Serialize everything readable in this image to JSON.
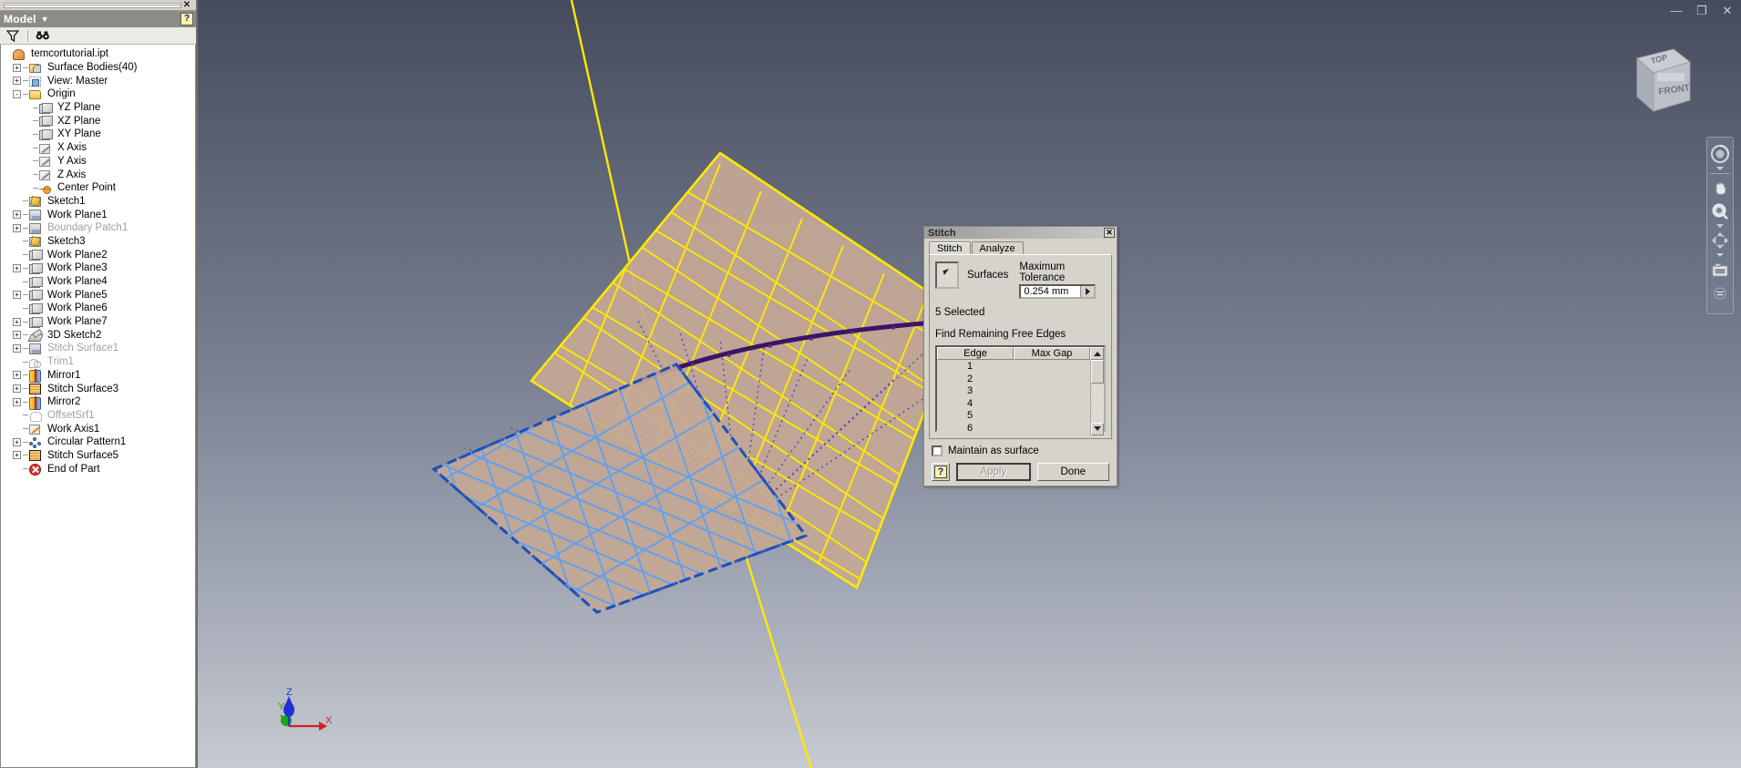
{
  "window": {
    "controls": [
      {
        "name": "minimize-button",
        "glyph": "—"
      },
      {
        "name": "restore-button",
        "glyph": "❐"
      },
      {
        "name": "close-button",
        "glyph": "✕"
      }
    ]
  },
  "browser": {
    "close_glyph": "✕",
    "title": "Model",
    "title_carat": "▼",
    "help_glyph": "?",
    "tools": [
      {
        "name": "filter-icon",
        "title": "Filter"
      },
      {
        "name": "find-icon",
        "title": "Find"
      }
    ],
    "tree": [
      {
        "label": "temcortutorial.ipt",
        "icon": "doc",
        "indent": 0,
        "expander": "none",
        "dim": false
      },
      {
        "label": "Surface Bodies(40)",
        "icon": "surfbody",
        "indent": 1,
        "expander": "+",
        "dim": false
      },
      {
        "label": "View: Master",
        "icon": "view",
        "indent": 1,
        "expander": "+",
        "dim": false
      },
      {
        "label": "Origin",
        "icon": "folder",
        "indent": 1,
        "expander": "-",
        "dim": false
      },
      {
        "label": "YZ Plane",
        "icon": "plane",
        "indent": 2,
        "expander": "none",
        "dim": false
      },
      {
        "label": "XZ Plane",
        "icon": "plane",
        "indent": 2,
        "expander": "none",
        "dim": false
      },
      {
        "label": "XY Plane",
        "icon": "plane",
        "indent": 2,
        "expander": "none",
        "dim": false
      },
      {
        "label": "X Axis",
        "icon": "axis",
        "indent": 2,
        "expander": "none",
        "dim": false
      },
      {
        "label": "Y Axis",
        "icon": "axis",
        "indent": 2,
        "expander": "none",
        "dim": false
      },
      {
        "label": "Z Axis",
        "icon": "axis",
        "indent": 2,
        "expander": "none",
        "dim": false
      },
      {
        "label": "Center Point",
        "icon": "cpt",
        "indent": 2,
        "expander": "none",
        "dim": false
      },
      {
        "label": "Sketch1",
        "icon": "sketch",
        "indent": 1,
        "expander": "none",
        "dim": false
      },
      {
        "label": "Work Plane1",
        "icon": "stitchsurf",
        "indent": 1,
        "expander": "+",
        "dim": false
      },
      {
        "label": "Boundary Patch1",
        "icon": "stitchsurf",
        "indent": 1,
        "expander": "+",
        "dim": true
      },
      {
        "label": "Sketch3",
        "icon": "sketch",
        "indent": 1,
        "expander": "none",
        "dim": false
      },
      {
        "label": "Work Plane2",
        "icon": "plane",
        "indent": 1,
        "expander": "none",
        "dim": false
      },
      {
        "label": "Work Plane3",
        "icon": "plane",
        "indent": 1,
        "expander": "+",
        "dim": false
      },
      {
        "label": "Work Plane4",
        "icon": "plane",
        "indent": 1,
        "expander": "none",
        "dim": false
      },
      {
        "label": "Work Plane5",
        "icon": "plane",
        "indent": 1,
        "expander": "+",
        "dim": false
      },
      {
        "label": "Work Plane6",
        "icon": "plane",
        "indent": 1,
        "expander": "none",
        "dim": false
      },
      {
        "label": "Work Plane7",
        "icon": "plane",
        "indent": 1,
        "expander": "+",
        "dim": false
      },
      {
        "label": "3D Sketch2",
        "icon": "sketch3d",
        "indent": 1,
        "expander": "+",
        "dim": false
      },
      {
        "label": "Stitch Surface1",
        "icon": "stitchsurf",
        "indent": 1,
        "expander": "+",
        "dim": true
      },
      {
        "label": "Trim1",
        "icon": "trim",
        "indent": 1,
        "expander": "none",
        "dim": true
      },
      {
        "label": "Mirror1",
        "icon": "mirror",
        "indent": 1,
        "expander": "+",
        "dim": false
      },
      {
        "label": "Stitch Surface3",
        "icon": "stitch",
        "indent": 1,
        "expander": "+",
        "dim": false
      },
      {
        "label": "Mirror2",
        "icon": "mirror",
        "indent": 1,
        "expander": "+",
        "dim": false
      },
      {
        "label": "OffsetSrf1",
        "icon": "offset",
        "indent": 1,
        "expander": "none",
        "dim": true
      },
      {
        "label": "Work Axis1",
        "icon": "axis-wk",
        "indent": 1,
        "expander": "none",
        "dim": false
      },
      {
        "label": "Circular Pattern1",
        "icon": "circpat",
        "indent": 1,
        "expander": "+",
        "dim": false
      },
      {
        "label": "Stitch Surface5",
        "icon": "stitch",
        "indent": 1,
        "expander": "+",
        "dim": false
      },
      {
        "label": "End of Part",
        "icon": "eop",
        "indent": 1,
        "expander": "none",
        "dim": false
      }
    ]
  },
  "stitch_dialog": {
    "title": "Stitch",
    "close_glyph": "✕",
    "tabs": [
      {
        "label": "Stitch",
        "active": true
      },
      {
        "label": "Analyze",
        "active": false
      }
    ],
    "surfaces_label": "Surfaces",
    "tolerance_label": "Maximum Tolerance",
    "tolerance_value": "0.254 mm",
    "tolerance_arrow": "▶",
    "selected_count": "5 Selected",
    "free_edges_label": "Find Remaining Free Edges",
    "grid": {
      "columns": [
        "Edge",
        "Max Gap"
      ],
      "rows": [
        {
          "edge": "1",
          "max_gap": ""
        },
        {
          "edge": "2",
          "max_gap": ""
        },
        {
          "edge": "3",
          "max_gap": ""
        },
        {
          "edge": "4",
          "max_gap": ""
        },
        {
          "edge": "5",
          "max_gap": ""
        },
        {
          "edge": "6",
          "max_gap": ""
        }
      ],
      "scroll_up_glyph": "▲",
      "scroll_down_glyph": "▼"
    },
    "maintain_label": "Maintain as surface",
    "maintain_checked": false,
    "help_glyph": "?",
    "apply_label": "Apply",
    "apply_enabled": false,
    "done_label": "Done"
  },
  "viewcube": {
    "top_face": "TOP",
    "front_face": "FRONT"
  },
  "navbar": {
    "items": [
      {
        "name": "steering-wheel-icon",
        "label": "Full Navigation Wheel"
      },
      {
        "name": "pan-icon",
        "label": "Pan"
      },
      {
        "name": "zoom-icon",
        "label": "Zoom"
      },
      {
        "name": "orbit-icon",
        "label": "Orbit"
      },
      {
        "name": "look-at-icon",
        "label": "Look At"
      }
    ]
  },
  "axis_triad": {
    "x_label": "X",
    "y_label": "Y",
    "z_label": "Z",
    "x_color": "#d42020",
    "y_color": "#1aa81a",
    "z_color": "#2030d8"
  },
  "colors": {
    "mesh_yellow": "#ffe800",
    "mesh_selected_blue": "#4f9cf0",
    "surface_tan": "#c4a894",
    "curve_purple": "#3a1566",
    "viewport_top": "#454c5e",
    "viewport_bottom": "#c6cad1",
    "browser_bg": "#eceae4",
    "dialog_bg": "#d6d3cb"
  }
}
